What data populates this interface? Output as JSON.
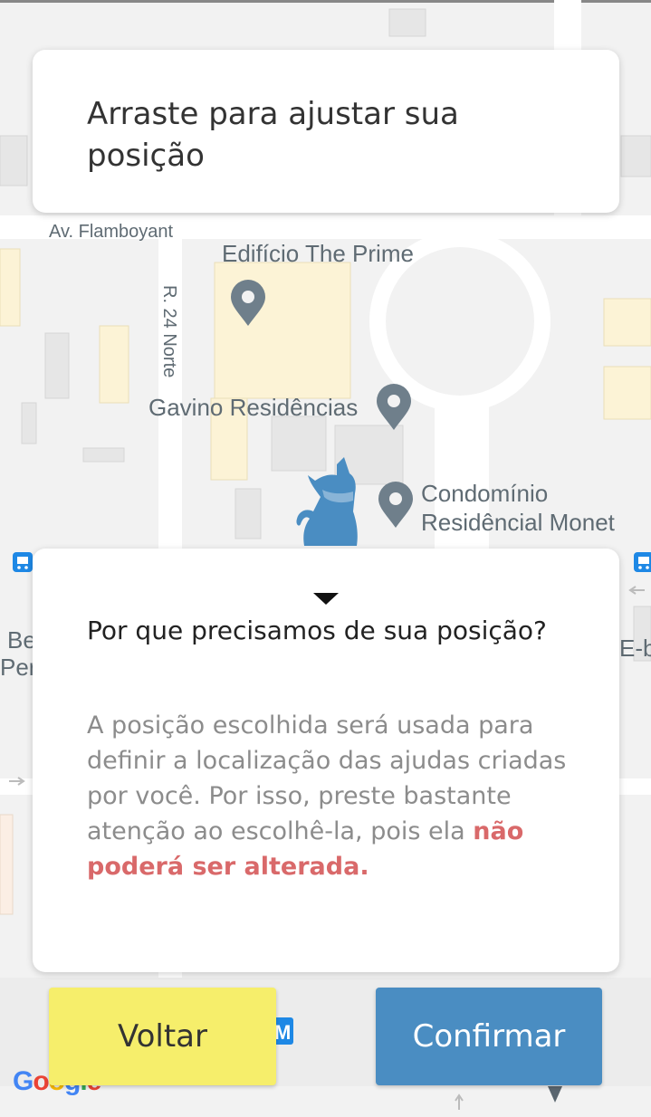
{
  "header": {
    "title": "Arraste para ajustar sua posição"
  },
  "map": {
    "labels": {
      "street_flamboyant": "Av. Flamboyant",
      "street_24_norte": "R. 24 Norte",
      "place_prime": "Edifício The Prime",
      "place_gavino": "Gavino Residências",
      "place_monet_1": "Condomínio",
      "place_monet_2": "Residêncial Monet",
      "partial_left_1": "Be",
      "partial_left_2": "Per",
      "partial_right": "E-b",
      "metro_badge": "M"
    },
    "google": [
      "G",
      "o",
      "o",
      "g",
      "l",
      "e"
    ],
    "google_colors": [
      "#4285F4",
      "#EA4335",
      "#FBBC05",
      "#4285F4",
      "#34A853",
      "#EA4335"
    ],
    "pin_color": "#6f7f8b",
    "marker_color": "#4a8dc2"
  },
  "info": {
    "heading": "Por que precisamos de sua posição?",
    "body": "A posição escolhida será usada para definir a localização das ajudas criadas por você. Por isso, preste bastante atenção ao escolhê-la, pois ela ",
    "warning": "não poderá ser alterada."
  },
  "buttons": {
    "back": "Voltar",
    "confirm": "Confirmar"
  }
}
